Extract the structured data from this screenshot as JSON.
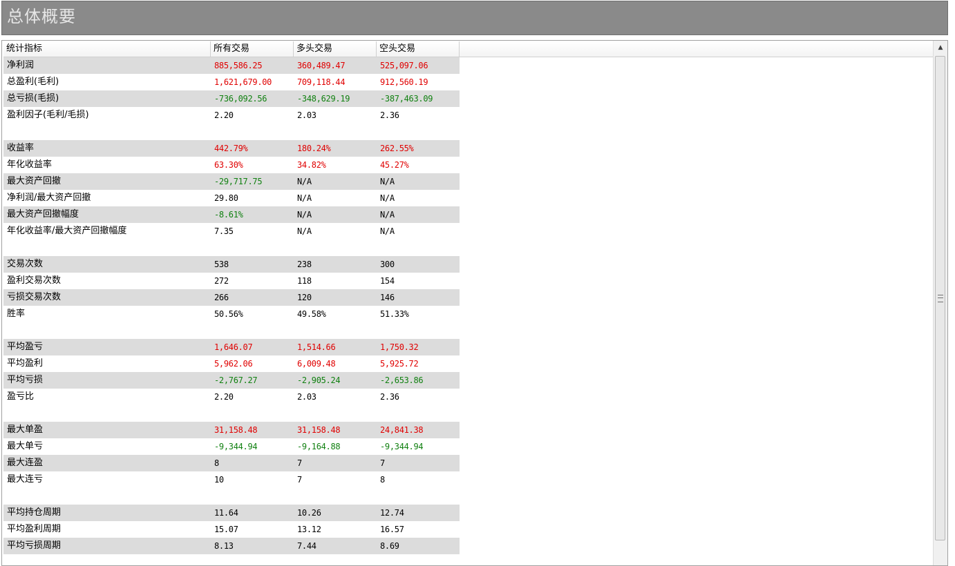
{
  "title": "总体概要",
  "table": {
    "headers": [
      "统计指标",
      "所有交易",
      "多头交易",
      "空头交易"
    ],
    "rows": [
      {
        "label": "净利润",
        "all": "885,586.25",
        "long": "360,489.47",
        "short": "525,097.06",
        "colors": [
          "red",
          "red",
          "red"
        ],
        "shaded": true
      },
      {
        "label": "总盈利(毛利)",
        "all": "1,621,679.00",
        "long": "709,118.44",
        "short": "912,560.19",
        "colors": [
          "red",
          "red",
          "red"
        ],
        "shaded": false
      },
      {
        "label": "总亏损(毛损)",
        "all": "-736,092.56",
        "long": "-348,629.19",
        "short": "-387,463.09",
        "colors": [
          "green",
          "green",
          "green"
        ],
        "shaded": true
      },
      {
        "label": "盈利因子(毛利/毛损)",
        "all": "2.20",
        "long": "2.03",
        "short": "2.36",
        "colors": [
          "black",
          "black",
          "black"
        ],
        "shaded": false
      },
      {
        "label": "",
        "all": "",
        "long": "",
        "short": "",
        "colors": [
          "black",
          "black",
          "black"
        ],
        "shaded": false
      },
      {
        "label": "收益率",
        "all": "442.79%",
        "long": "180.24%",
        "short": "262.55%",
        "colors": [
          "red",
          "red",
          "red"
        ],
        "shaded": true
      },
      {
        "label": "年化收益率",
        "all": "63.30%",
        "long": "34.82%",
        "short": "45.27%",
        "colors": [
          "red",
          "red",
          "red"
        ],
        "shaded": false
      },
      {
        "label": "最大资产回撤",
        "all": "-29,717.75",
        "long": "N/A",
        "short": "N/A",
        "colors": [
          "green",
          "black",
          "black"
        ],
        "shaded": true
      },
      {
        "label": "净利润/最大资产回撤",
        "all": "29.80",
        "long": "N/A",
        "short": "N/A",
        "colors": [
          "black",
          "black",
          "black"
        ],
        "shaded": false
      },
      {
        "label": "最大资产回撤幅度",
        "all": "-8.61%",
        "long": "N/A",
        "short": "N/A",
        "colors": [
          "green",
          "black",
          "black"
        ],
        "shaded": true
      },
      {
        "label": "年化收益率/最大资产回撤幅度",
        "all": "7.35",
        "long": "N/A",
        "short": "N/A",
        "colors": [
          "black",
          "black",
          "black"
        ],
        "shaded": false
      },
      {
        "label": "",
        "all": "",
        "long": "",
        "short": "",
        "colors": [
          "black",
          "black",
          "black"
        ],
        "shaded": false
      },
      {
        "label": "交易次数",
        "all": "538",
        "long": "238",
        "short": "300",
        "colors": [
          "black",
          "black",
          "black"
        ],
        "shaded": true
      },
      {
        "label": "盈利交易次数",
        "all": "272",
        "long": "118",
        "short": "154",
        "colors": [
          "black",
          "black",
          "black"
        ],
        "shaded": false
      },
      {
        "label": "亏损交易次数",
        "all": "266",
        "long": "120",
        "short": "146",
        "colors": [
          "black",
          "black",
          "black"
        ],
        "shaded": true
      },
      {
        "label": "胜率",
        "all": "50.56%",
        "long": "49.58%",
        "short": "51.33%",
        "colors": [
          "black",
          "black",
          "black"
        ],
        "shaded": false
      },
      {
        "label": "",
        "all": "",
        "long": "",
        "short": "",
        "colors": [
          "black",
          "black",
          "black"
        ],
        "shaded": false
      },
      {
        "label": "平均盈亏",
        "all": "1,646.07",
        "long": "1,514.66",
        "short": "1,750.32",
        "colors": [
          "red",
          "red",
          "red"
        ],
        "shaded": true
      },
      {
        "label": "平均盈利",
        "all": "5,962.06",
        "long": "6,009.48",
        "short": "5,925.72",
        "colors": [
          "red",
          "red",
          "red"
        ],
        "shaded": false
      },
      {
        "label": "平均亏损",
        "all": "-2,767.27",
        "long": "-2,905.24",
        "short": "-2,653.86",
        "colors": [
          "green",
          "green",
          "green"
        ],
        "shaded": true
      },
      {
        "label": "盈亏比",
        "all": "2.20",
        "long": "2.03",
        "short": "2.36",
        "colors": [
          "black",
          "black",
          "black"
        ],
        "shaded": false
      },
      {
        "label": "",
        "all": "",
        "long": "",
        "short": "",
        "colors": [
          "black",
          "black",
          "black"
        ],
        "shaded": false
      },
      {
        "label": "最大单盈",
        "all": "31,158.48",
        "long": "31,158.48",
        "short": "24,841.38",
        "colors": [
          "red",
          "red",
          "red"
        ],
        "shaded": true
      },
      {
        "label": "最大单亏",
        "all": "-9,344.94",
        "long": "-9,164.88",
        "short": "-9,344.94",
        "colors": [
          "green",
          "green",
          "green"
        ],
        "shaded": false
      },
      {
        "label": "最大连盈",
        "all": "8",
        "long": "7",
        "short": "7",
        "colors": [
          "black",
          "black",
          "black"
        ],
        "shaded": true
      },
      {
        "label": "最大连亏",
        "all": "10",
        "long": "7",
        "short": "8",
        "colors": [
          "black",
          "black",
          "black"
        ],
        "shaded": false
      },
      {
        "label": "",
        "all": "",
        "long": "",
        "short": "",
        "colors": [
          "black",
          "black",
          "black"
        ],
        "shaded": false
      },
      {
        "label": "平均持仓周期",
        "all": "11.64",
        "long": "10.26",
        "short": "12.74",
        "colors": [
          "black",
          "black",
          "black"
        ],
        "shaded": true
      },
      {
        "label": "平均盈利周期",
        "all": "15.07",
        "long": "13.12",
        "short": "16.57",
        "colors": [
          "black",
          "black",
          "black"
        ],
        "shaded": false
      },
      {
        "label": "平均亏损周期",
        "all": "8.13",
        "long": "7.44",
        "short": "8.69",
        "colors": [
          "black",
          "black",
          "black"
        ],
        "shaded": true
      }
    ]
  },
  "colors": {
    "positive": "#e00000",
    "negative": "#108010",
    "shaded_row": "#dcdcdc",
    "title_bar": "#8a8a8a"
  },
  "icons": {
    "scroll_up": "scroll-up-arrow-icon",
    "grip": "scroll-grip-icon"
  }
}
